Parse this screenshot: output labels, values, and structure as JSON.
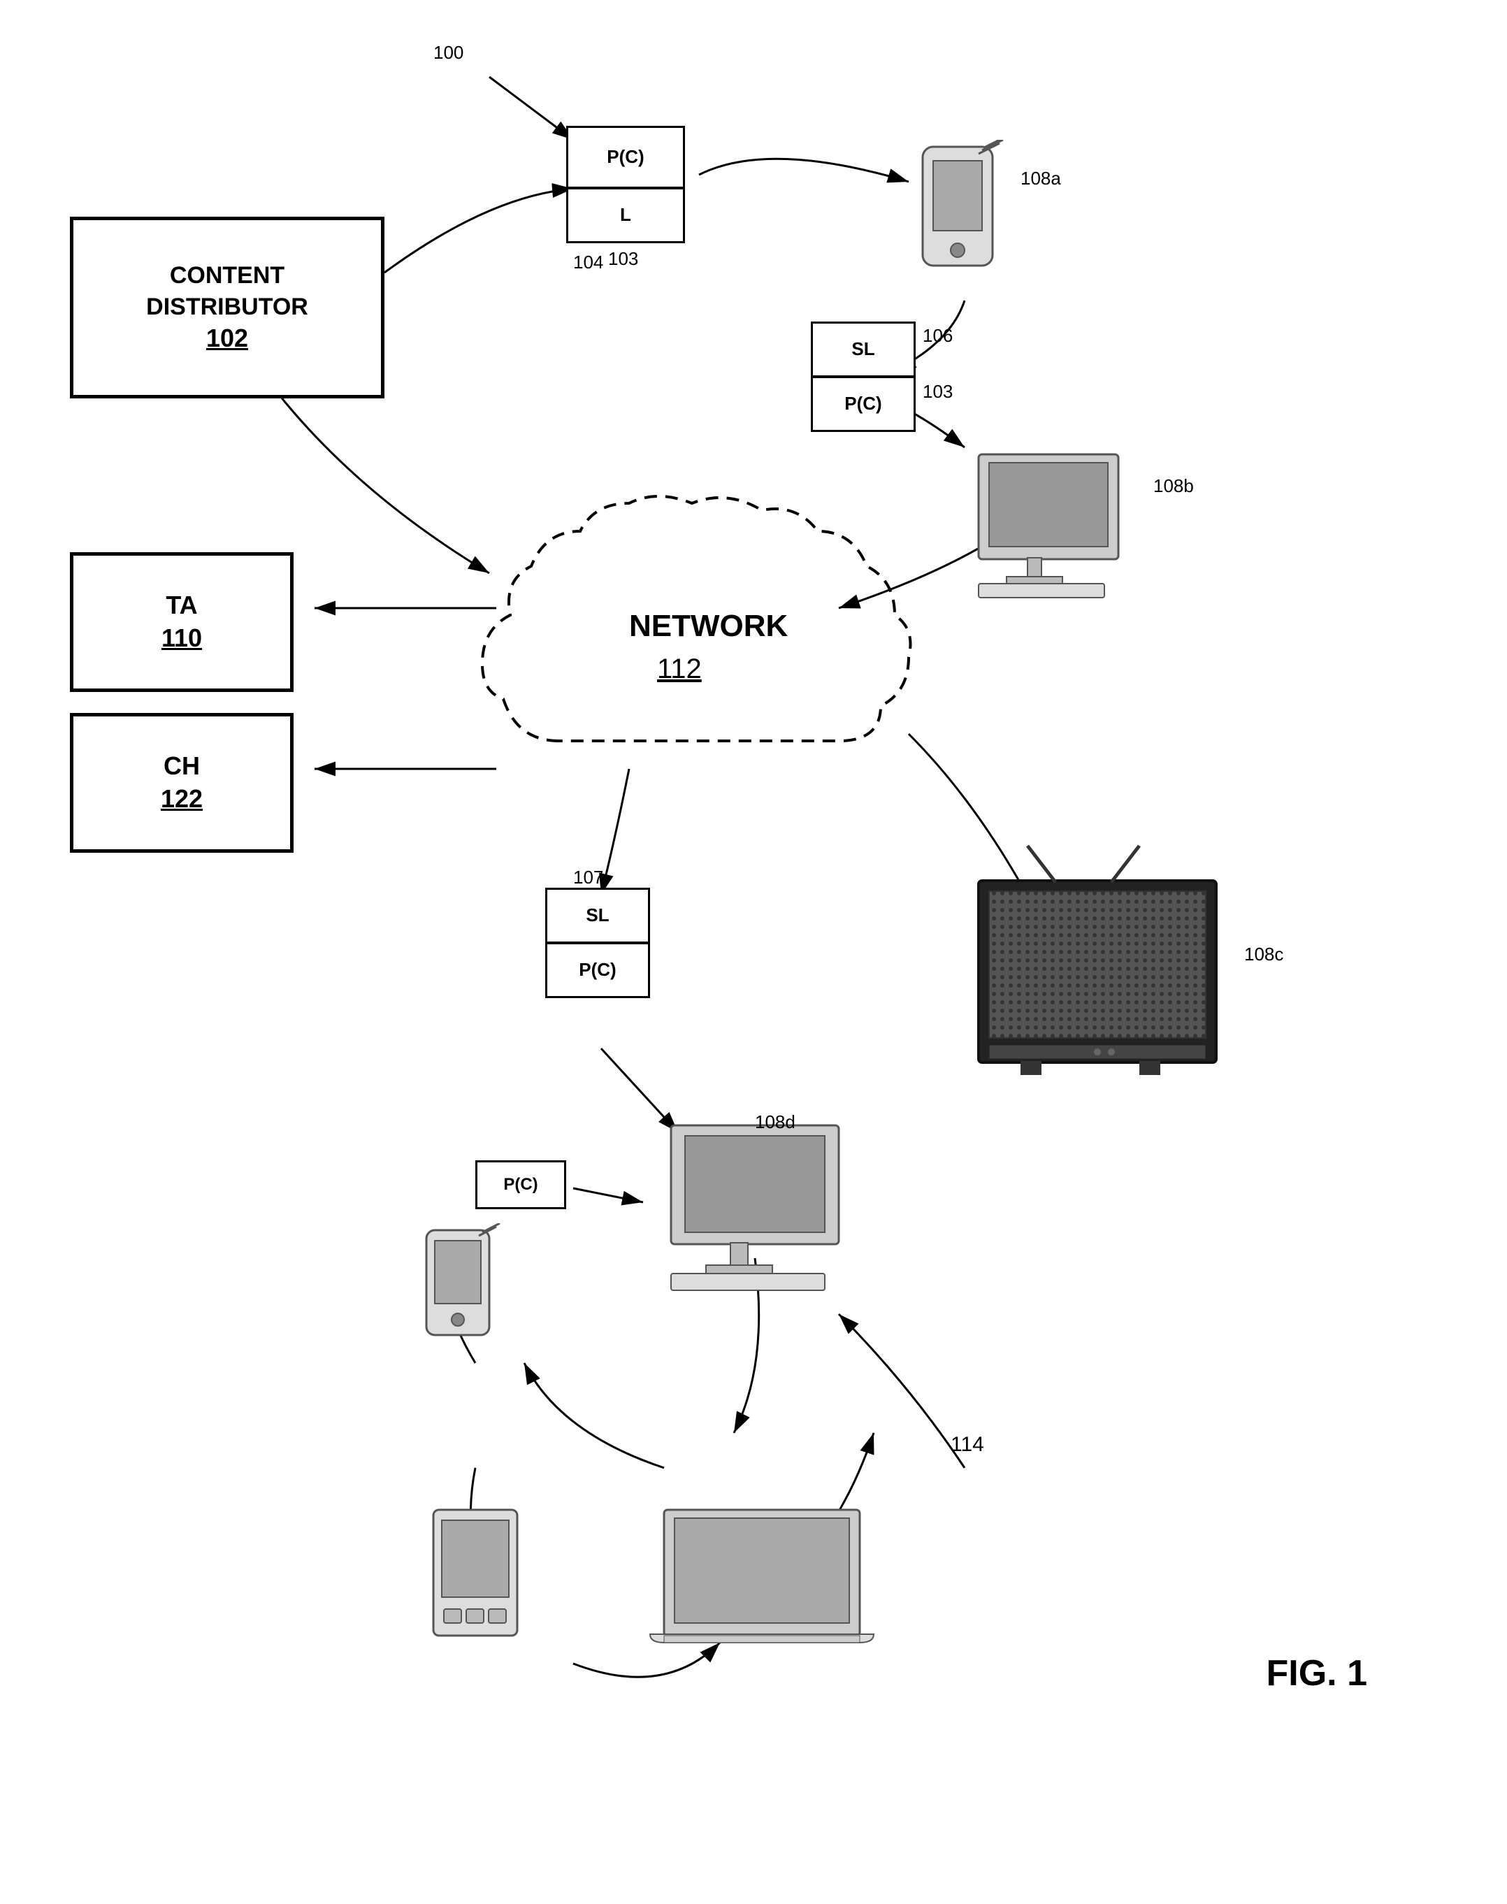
{
  "title": "FIG. 1",
  "diagram": {
    "ref_100": "100",
    "ref_103a": "103",
    "ref_104": "104",
    "ref_108a": "108a",
    "ref_106": "106",
    "ref_103b": "103",
    "ref_112": "112",
    "network_label": "NETWORK",
    "network_ref": "112",
    "ref_108b": "108b",
    "ref_108c": "108c",
    "ref_107": "107",
    "ref_108d": "108d",
    "ref_114": "114",
    "ref_110": "110",
    "ref_122": "122",
    "content_distributor_label": "CONTENT\nDISTRIBUTOR",
    "content_distributor_ref": "102",
    "ta_label": "TA",
    "ta_ref": "110",
    "ch_label": "CH",
    "ch_ref": "122",
    "fig_label": "FIG. 1",
    "pc_label": "P(C)",
    "l_label": "L",
    "sl_label": "SL"
  }
}
